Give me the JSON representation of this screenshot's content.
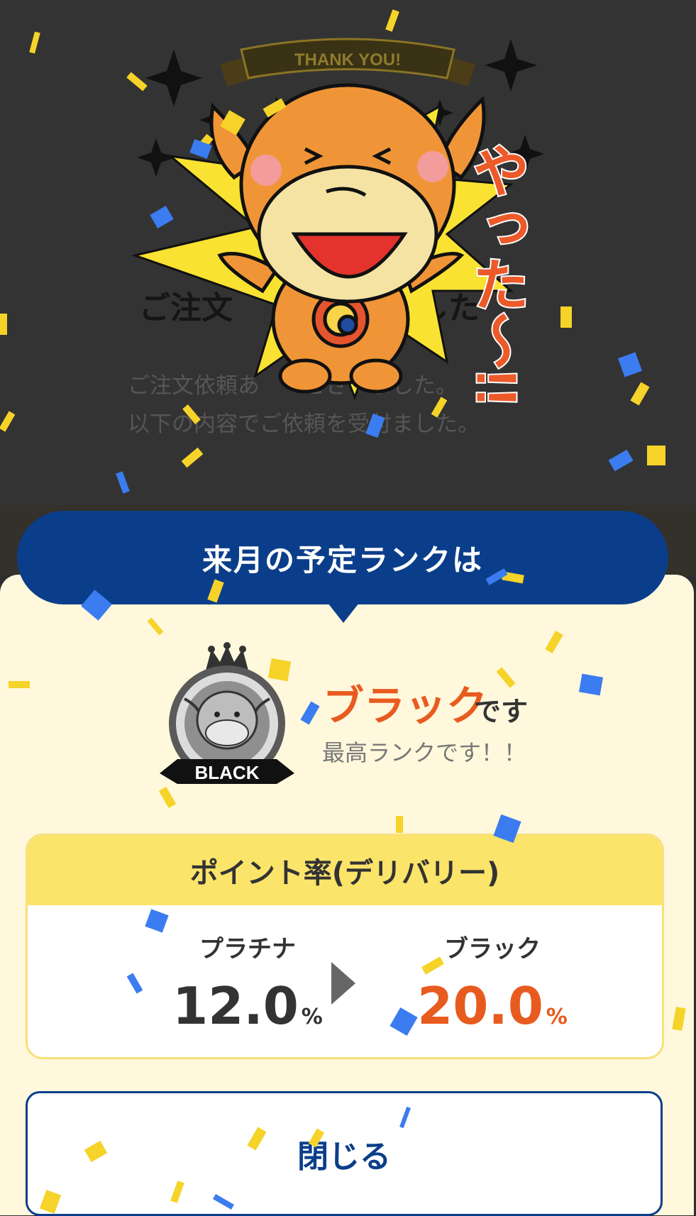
{
  "background_page": {
    "title": "ご注文",
    "title_tail": "した",
    "line1": "ご注文依頼あ　　ございました。",
    "line2": "以下の内容でご依頼を受付ました。"
  },
  "celebration": {
    "ribbon_text": "THANK YOU!",
    "exclamation": "やった〜!!"
  },
  "modal": {
    "banner_title": "来月の予定ランクは",
    "badge_label": "BLACK",
    "rank_name": "ブラック",
    "rank_suffix": "です",
    "rank_note": "最高ランクです！！",
    "rate_card": {
      "title": "ポイント率(デリバリー)",
      "current": {
        "label": "プラチナ",
        "value": "12.0",
        "unit": "%"
      },
      "next": {
        "label": "ブラック",
        "value": "20.0",
        "unit": "%"
      }
    },
    "close_label": "閉じる"
  },
  "colors": {
    "banner": "#0b3e8a",
    "accent_orange": "#e85b1f",
    "card_header": "#fbe46a",
    "modal_bg": "#fff8dc"
  }
}
